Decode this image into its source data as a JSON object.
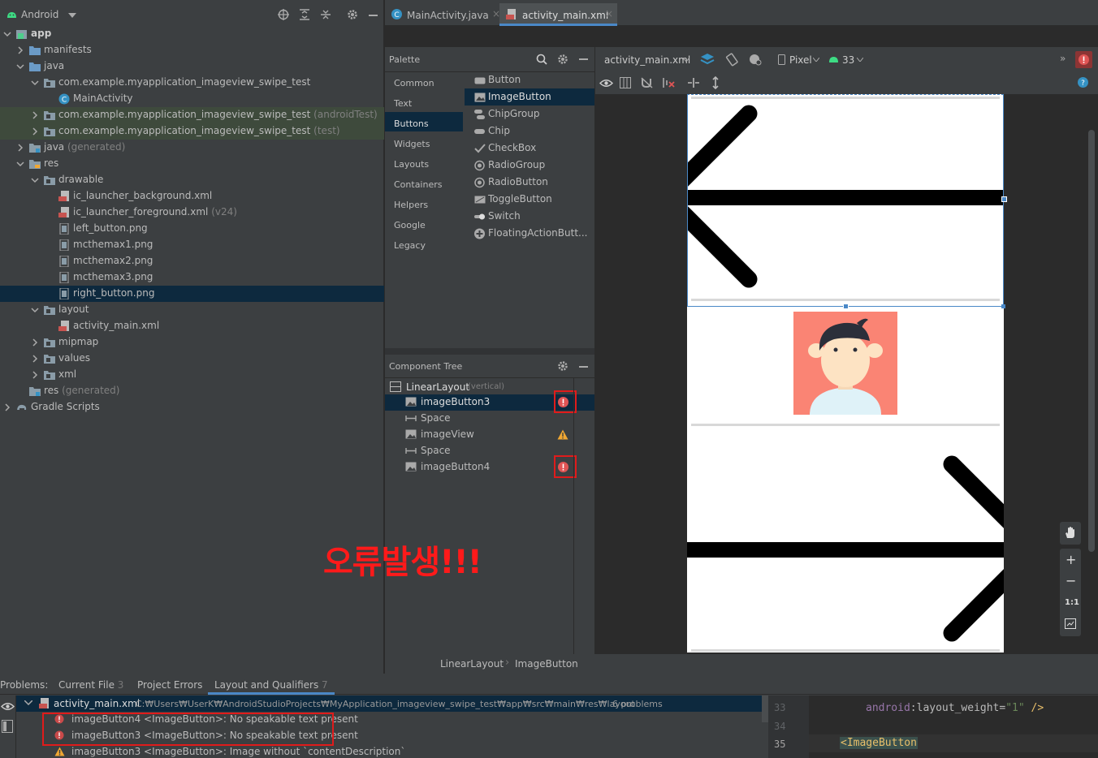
{
  "project": {
    "view_selector": "Android",
    "tree": [
      {
        "label": "app",
        "depth": 0,
        "arrow": "down",
        "icon": "module"
      },
      {
        "label": "manifests",
        "depth": 1,
        "arrow": "right",
        "icon": "folder"
      },
      {
        "label": "java",
        "depth": 1,
        "arrow": "down",
        "icon": "folder"
      },
      {
        "label": "com.example.myapplication_imageview_swipe_test",
        "depth": 2,
        "arrow": "down",
        "icon": "package"
      },
      {
        "label": "MainActivity",
        "depth": 3,
        "arrow": "",
        "icon": "class"
      },
      {
        "label": "com.example.myapplication_imageview_swipe_test",
        "suffix": "(androidTest)",
        "depth": 2,
        "arrow": "right",
        "icon": "package",
        "hl": "test"
      },
      {
        "label": "com.example.myapplication_imageview_swipe_test",
        "suffix": "(test)",
        "depth": 2,
        "arrow": "right",
        "icon": "package",
        "hl": "test"
      },
      {
        "label": "java",
        "suffix": "(generated)",
        "depth": 1,
        "arrow": "right",
        "icon": "gen"
      },
      {
        "label": "res",
        "depth": 1,
        "arrow": "down",
        "icon": "res"
      },
      {
        "label": "drawable",
        "depth": 2,
        "arrow": "down",
        "icon": "package"
      },
      {
        "label": "ic_launcher_background.xml",
        "depth": 3,
        "arrow": "",
        "icon": "xml"
      },
      {
        "label": "ic_launcher_foreground.xml",
        "suffix": "(v24)",
        "depth": 3,
        "arrow": "",
        "icon": "xml"
      },
      {
        "label": "left_button.png",
        "depth": 3,
        "arrow": "",
        "icon": "png"
      },
      {
        "label": "mcthemax1.png",
        "depth": 3,
        "arrow": "",
        "icon": "png"
      },
      {
        "label": "mcthemax2.png",
        "depth": 3,
        "arrow": "",
        "icon": "png"
      },
      {
        "label": "mcthemax3.png",
        "depth": 3,
        "arrow": "",
        "icon": "png"
      },
      {
        "label": "right_button.png",
        "depth": 3,
        "arrow": "",
        "icon": "png",
        "hl": "sel"
      },
      {
        "label": "layout",
        "depth": 2,
        "arrow": "down",
        "icon": "package"
      },
      {
        "label": "activity_main.xml",
        "depth": 3,
        "arrow": "",
        "icon": "xml"
      },
      {
        "label": "mipmap",
        "depth": 2,
        "arrow": "right",
        "icon": "package"
      },
      {
        "label": "values",
        "depth": 2,
        "arrow": "right",
        "icon": "package"
      },
      {
        "label": "xml",
        "depth": 2,
        "arrow": "right",
        "icon": "package"
      },
      {
        "label": "res",
        "suffix": "(generated)",
        "depth": 1,
        "arrow": "",
        "icon": "gen"
      },
      {
        "label": "Gradle Scripts",
        "depth": 0,
        "arrow": "right",
        "icon": "gradle"
      }
    ]
  },
  "tabs": [
    {
      "label": "MainActivity.java",
      "icon": "class"
    },
    {
      "label": "activity_main.xml",
      "icon": "xml",
      "active": true
    }
  ],
  "palette": {
    "title": "Palette",
    "categories": [
      "Common",
      "Text",
      "Buttons",
      "Widgets",
      "Layouts",
      "Containers",
      "Helpers",
      "Google",
      "Legacy"
    ],
    "selected_category": "Buttons",
    "items": [
      "Button",
      "ImageButton",
      "ChipGroup",
      "Chip",
      "CheckBox",
      "RadioGroup",
      "RadioButton",
      "ToggleButton",
      "Switch",
      "FloatingActionButt..."
    ],
    "selected_item": "ImageButton"
  },
  "component_tree": {
    "title": "Component Tree",
    "root": {
      "label": "LinearLayout",
      "suffix": "(vertical)"
    },
    "children": [
      {
        "label": "imageButton3",
        "icon": "image",
        "status": "error",
        "selected": true
      },
      {
        "label": "Space",
        "icon": "space",
        "status": ""
      },
      {
        "label": "imageView",
        "icon": "image",
        "status": "warning"
      },
      {
        "label": "Space",
        "icon": "space",
        "status": ""
      },
      {
        "label": "imageButton4",
        "icon": "image",
        "status": "error"
      }
    ]
  },
  "design_toolbar": {
    "file": "activity_main.xml",
    "device": "Pixel",
    "api": "33"
  },
  "breadcrumb": [
    "LinearLayout",
    "ImageButton"
  ],
  "overlay_text": "오류발생!!!",
  "zoom_controls": [
    "+",
    "−",
    "1:1"
  ],
  "problems": {
    "label": "Problems:",
    "tabs": [
      {
        "label": "Current File",
        "count": "3"
      },
      {
        "label": "Project Errors",
        "count": ""
      },
      {
        "label": "Layout and Qualifiers",
        "count": "7",
        "active": true
      }
    ],
    "file": "activity_main.xml",
    "path": "C:₩Users₩UserK₩AndroidStudioProjects₩MyApplication_imageview_swipe_test₩app₩src₩main₩res₩layout",
    "count_text": "6 problems",
    "items": [
      {
        "severity": "error",
        "text": "imageButton4 <ImageButton>: No speakable text present"
      },
      {
        "severity": "error",
        "text": "imageButton3 <ImageButton>: No speakable text present"
      },
      {
        "severity": "warning",
        "text": "imageButton3 <ImageButton>: Image without `contentDescription`"
      }
    ]
  },
  "code": {
    "line_numbers": [
      "33",
      "34",
      "35"
    ],
    "attr_ns": "android",
    "attr_name": "layout_weight",
    "attr_value": "\"1\"",
    "attr_close": "/>",
    "tag_line": "<ImageButton"
  },
  "colors": {
    "error": "#e05555",
    "warning": "#f0a732",
    "selection": "#0d293e",
    "accent": "#4a88c7",
    "annotation_red": "#ff1a1a"
  }
}
